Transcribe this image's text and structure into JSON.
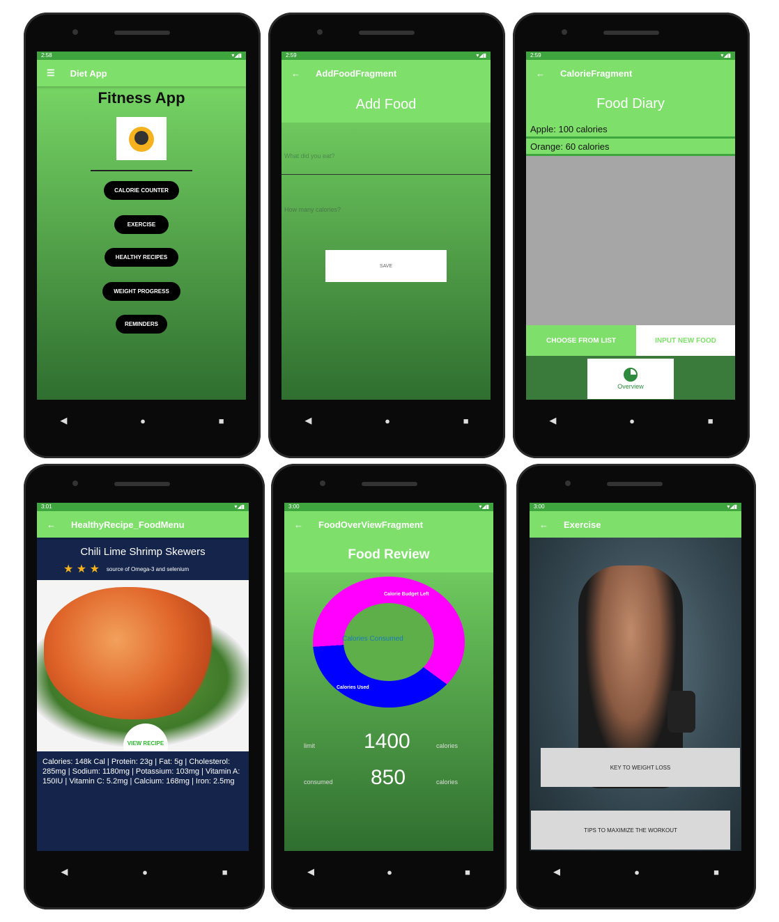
{
  "s1": {
    "time": "2:58",
    "appbar_title": "Diet App",
    "title": "Fitness App",
    "buttons": [
      "CALORIE COUNTER",
      "EXERCISE",
      "HEALTHY RECIPES",
      "WEIGHT PROGRESS",
      "REMINDERS"
    ]
  },
  "s2": {
    "time": "2:59",
    "appbar_title": "AddFoodFragment",
    "heading": "Add Food",
    "food_placeholder": "What did you eat?",
    "cal_placeholder": "How many calories?",
    "save_label": "SAVE"
  },
  "s3": {
    "time": "2:59",
    "appbar_title": "CalorieFragment",
    "heading": "Food Diary",
    "entries": [
      "Apple: 100 calories",
      "Orange: 60 calories"
    ],
    "btn_choose": "CHOOSE FROM LIST",
    "btn_input": "INPUT NEW FOOD",
    "overview": "Overview"
  },
  "s4": {
    "time": "3:01",
    "appbar_title": "HealthyRecipe_FoodMenu",
    "recipe_title": "Chili Lime Shrimp Skewers",
    "stars": "★ ★ ★",
    "tagline": "source of Omega-3 and selenium",
    "view_btn": "VIEW RECIPE",
    "nutrition": "Calories: 148k Cal | Protein: 23g | Fat: 5g | Cholesterol: 285mg | Sodium: 1180mg | Potassium: 103mg | Vitamin A: 150IU | Vitamin C: 5.2mg | Calcium: 168mg | Iron: 2.5mg"
  },
  "s5": {
    "time": "3:00",
    "appbar_title": "FoodOverViewFragment",
    "heading": "Food Review",
    "donut_budget": "Calorie Budget Left",
    "donut_center": "Calories Consumed",
    "donut_used": "Calories Used",
    "limit_label": "limit",
    "limit_value": "1400",
    "limit_unit": "calories",
    "consumed_label": "consumed",
    "consumed_value": "850",
    "consumed_unit": "calories"
  },
  "s6": {
    "time": "3:00",
    "appbar_title": "Exercise",
    "btn_key": "KEY TO WEIGHT LOSS",
    "btn_tips": "TIPS TO MAXIMIZE THE WORKOUT"
  },
  "nav": {
    "back": "◀",
    "home": "●",
    "recent": "■"
  }
}
